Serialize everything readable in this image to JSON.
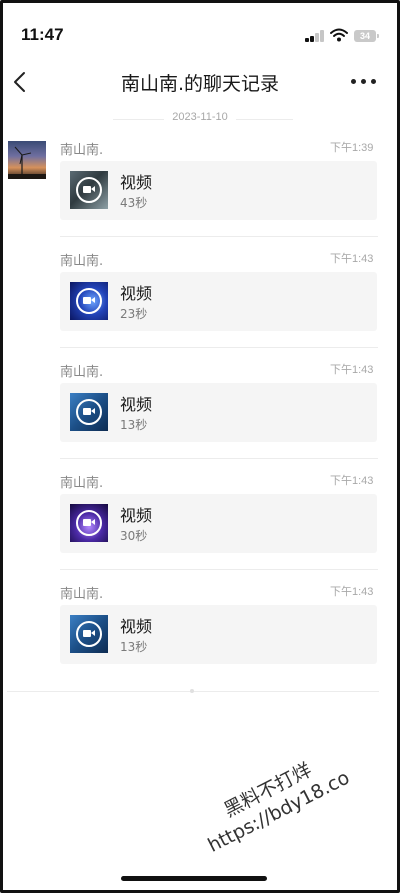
{
  "status_bar": {
    "time": "11:47",
    "battery": "34"
  },
  "nav": {
    "title": "南山南.的聊天记录"
  },
  "date_separator": "2023-11-10",
  "messages": [
    {
      "sender": "南山南.",
      "time": "下午1:39",
      "card": {
        "label": "视频",
        "duration": "43秒"
      }
    },
    {
      "sender": "南山南.",
      "time": "下午1:43",
      "card": {
        "label": "视频",
        "duration": "23秒"
      }
    },
    {
      "sender": "南山南.",
      "time": "下午1:43",
      "card": {
        "label": "视频",
        "duration": "13秒"
      }
    },
    {
      "sender": "南山南.",
      "time": "下午1:43",
      "card": {
        "label": "视频",
        "duration": "30秒"
      }
    },
    {
      "sender": "南山南.",
      "time": "下午1:43",
      "card": {
        "label": "视频",
        "duration": "13秒"
      }
    }
  ],
  "watermark": {
    "line1": "黑料不打烊",
    "line2": "https://bdy18.co"
  },
  "colors": {
    "background": "#ffffff",
    "card_bg": "#f5f5f5",
    "meta_text": "#a8a8a8"
  },
  "icons": [
    "signal-icon",
    "wifi-icon",
    "battery-icon",
    "back-chevron-icon",
    "more-dots-icon",
    "video-play-icon"
  ]
}
